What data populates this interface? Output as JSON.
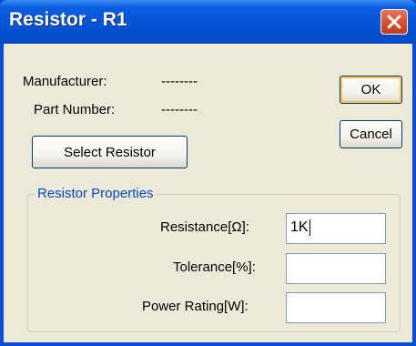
{
  "window": {
    "title": "Resistor - R1",
    "close_icon": "close-icon"
  },
  "info": {
    "manufacturer_label": "Manufacturer:",
    "manufacturer_value": "--------",
    "part_number_label": "Part Number:",
    "part_number_value": "--------"
  },
  "buttons": {
    "ok_label": "OK",
    "cancel_label": "Cancel",
    "select_resistor_label": "Select Resistor"
  },
  "properties": {
    "group_title": "Resistor Properties",
    "resistance_label": "Resistance[Ω]:",
    "resistance_value": "1K",
    "tolerance_label": "Tolerance[%]:",
    "tolerance_value": "",
    "power_rating_label": "Power Rating[W]:",
    "power_rating_value": ""
  },
  "colors": {
    "titlebar": "#0553d6",
    "dialog_background": "#ece9d8",
    "close_button": "#d9502f",
    "group_title": "#0046d5"
  }
}
